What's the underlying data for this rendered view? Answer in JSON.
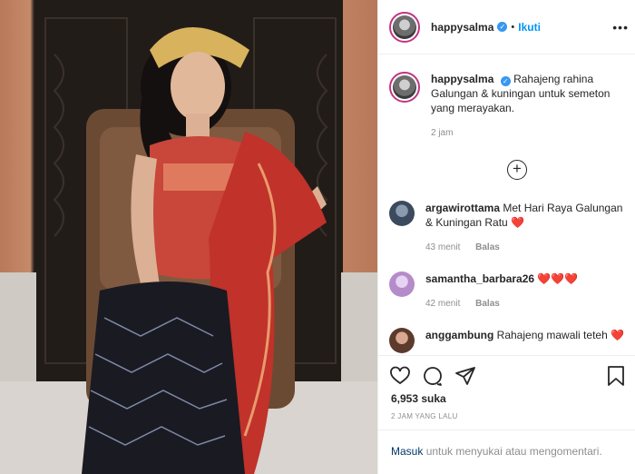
{
  "post": {
    "username": "happysalma",
    "follow_label": "Ikuti",
    "dot": "•",
    "more": "•••",
    "caption": "Rahajeng rahina Galungan & kuningan untuk semeton yang merayakan.",
    "caption_time": "2 jam"
  },
  "comments": [
    {
      "user": "argawirottama",
      "text": "Met Hari Raya Galungan & Kuningan Ratu",
      "heart": "❤️",
      "time": "43 menit",
      "reply": "Balas"
    },
    {
      "user": "samantha_barbara26",
      "text": "",
      "heart": "❤️❤️❤️",
      "time": "42 menit",
      "reply": "Balas"
    },
    {
      "user": "anggambung",
      "text": "Rahajeng mawali teteh",
      "heart": "❤️",
      "time": "",
      "reply": ""
    }
  ],
  "stats": {
    "likes": "6,953 suka",
    "posted": "2 JAM YANG LALU"
  },
  "login": {
    "link": "Masuk",
    "text": "untuk menyukai atau mengomentari."
  },
  "colors": {
    "accent": "#0095f6",
    "heart": "#ed4956",
    "ring": "#c13584"
  },
  "icons": [
    "heart-icon",
    "comment-icon",
    "share-icon",
    "bookmark-icon",
    "add-comment-icon",
    "verified-icon",
    "more-options-icon"
  ]
}
